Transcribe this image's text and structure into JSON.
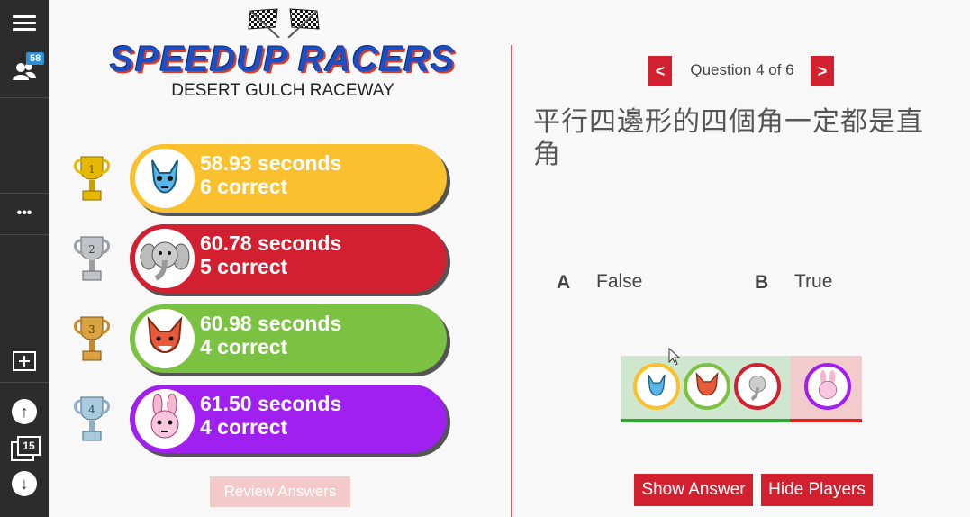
{
  "sidebar": {
    "participants_count": "58",
    "more_label": "•••",
    "slides_count": "15",
    "up_label": "↑",
    "down_label": "↓"
  },
  "logo": {
    "title": "SPEEDUP RACERS",
    "subtitle": "DESERT GULCH RACEWAY"
  },
  "leaderboard": [
    {
      "place": "1",
      "time": "58.93 seconds",
      "correct": "6 correct",
      "color": "#fbc02d",
      "avatar": "wolf-icon"
    },
    {
      "place": "2",
      "time": "60.78 seconds",
      "correct": "5 correct",
      "color": "#d32030",
      "avatar": "elephant-icon"
    },
    {
      "place": "3",
      "time": "60.98 seconds",
      "correct": "4 correct",
      "color": "#7cc242",
      "avatar": "fox-icon"
    },
    {
      "place": "4",
      "time": "61.50 seconds",
      "correct": "4 correct",
      "color": "#a020f0",
      "avatar": "rabbit-icon"
    }
  ],
  "review_label": "Review Answers",
  "question": {
    "prev_label": "<",
    "next_label": ">",
    "counter": "Question 4 of 6",
    "text": "平行四邊形的四個角一定都是直角"
  },
  "options": [
    {
      "letter": "A",
      "text": "False"
    },
    {
      "letter": "B",
      "text": "True"
    }
  ],
  "actions": {
    "show_answer": "Show Answer",
    "hide_players": "Hide Players"
  },
  "colors": {
    "accent_red": "#d2202f",
    "correct_green": "#2ea72e"
  }
}
